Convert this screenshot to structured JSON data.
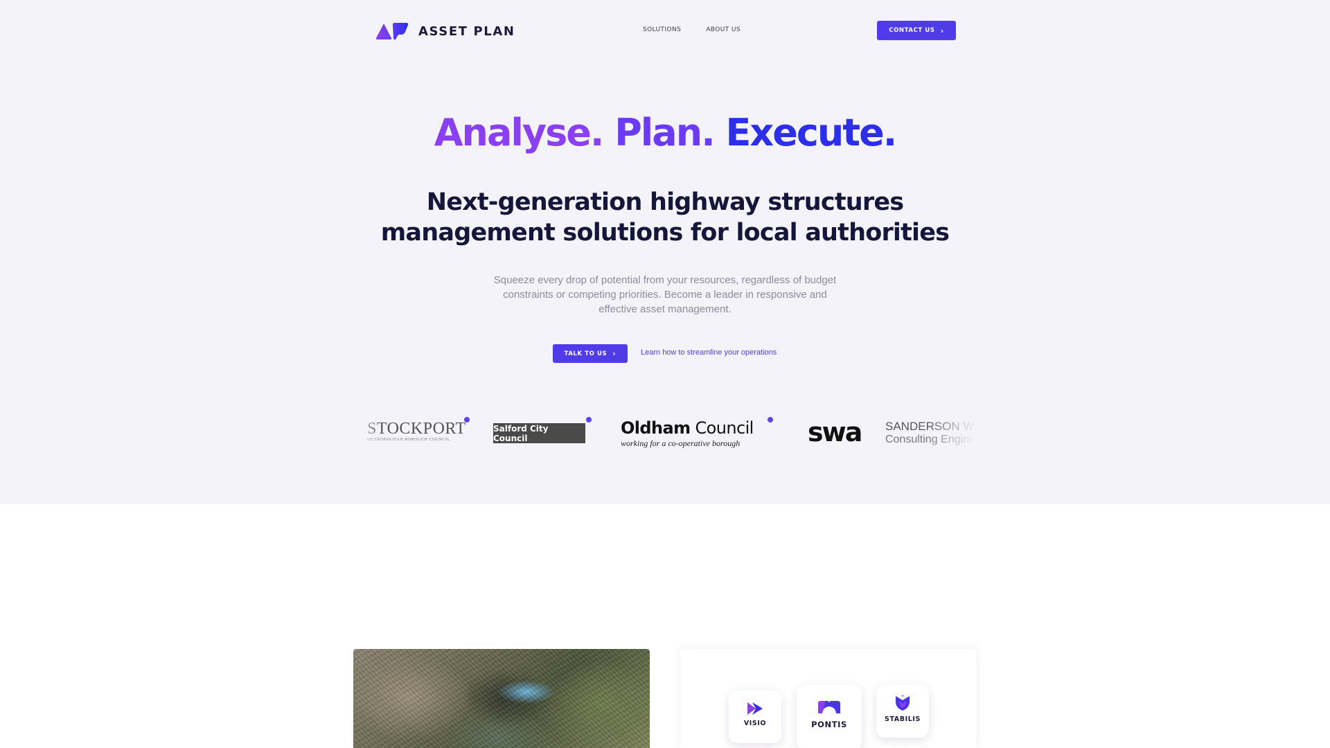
{
  "brand": {
    "name": "ASSET PLAN",
    "accent": "#4f3ce8",
    "purple": "#8a3ff0",
    "blue": "#2d2ee8"
  },
  "nav": {
    "links": [
      "SOLUTIONS",
      "ABOUT US"
    ],
    "contact_label": "CONTACT US"
  },
  "hero": {
    "tagline": [
      "Analyse.",
      "Plan.",
      "Execute."
    ],
    "headline_line1": "Next-generation highway structures",
    "headline_line2": "management solutions for local authorities",
    "subtext": "Squeeze every drop of potential from your resources, regardless of budget constraints or competing priorities. Become a leader in responsive and effective asset management.",
    "cta_label": "TALK TO US",
    "learn_link": "Learn how to streamline your operations"
  },
  "clients": {
    "stockport": {
      "name": "STOCKPORT",
      "sub": "METROPOLITAN BOROUGH COUNCIL"
    },
    "salford": {
      "name": "Salford City Council"
    },
    "oldham": {
      "name_bold": "Oldham",
      "name_rest": " Council",
      "sub": "working for a co-operative borough"
    },
    "swa": {
      "mark": "swa",
      "line1": "SANDERSON WEATHERALL",
      "line2": "Consulting Engineers"
    }
  },
  "products": [
    {
      "name": "VISIO",
      "icon": "visio-icon"
    },
    {
      "name": "PONTIS",
      "icon": "pontis-icon"
    },
    {
      "name": "STABILIS",
      "icon": "stabilis-icon"
    }
  ]
}
